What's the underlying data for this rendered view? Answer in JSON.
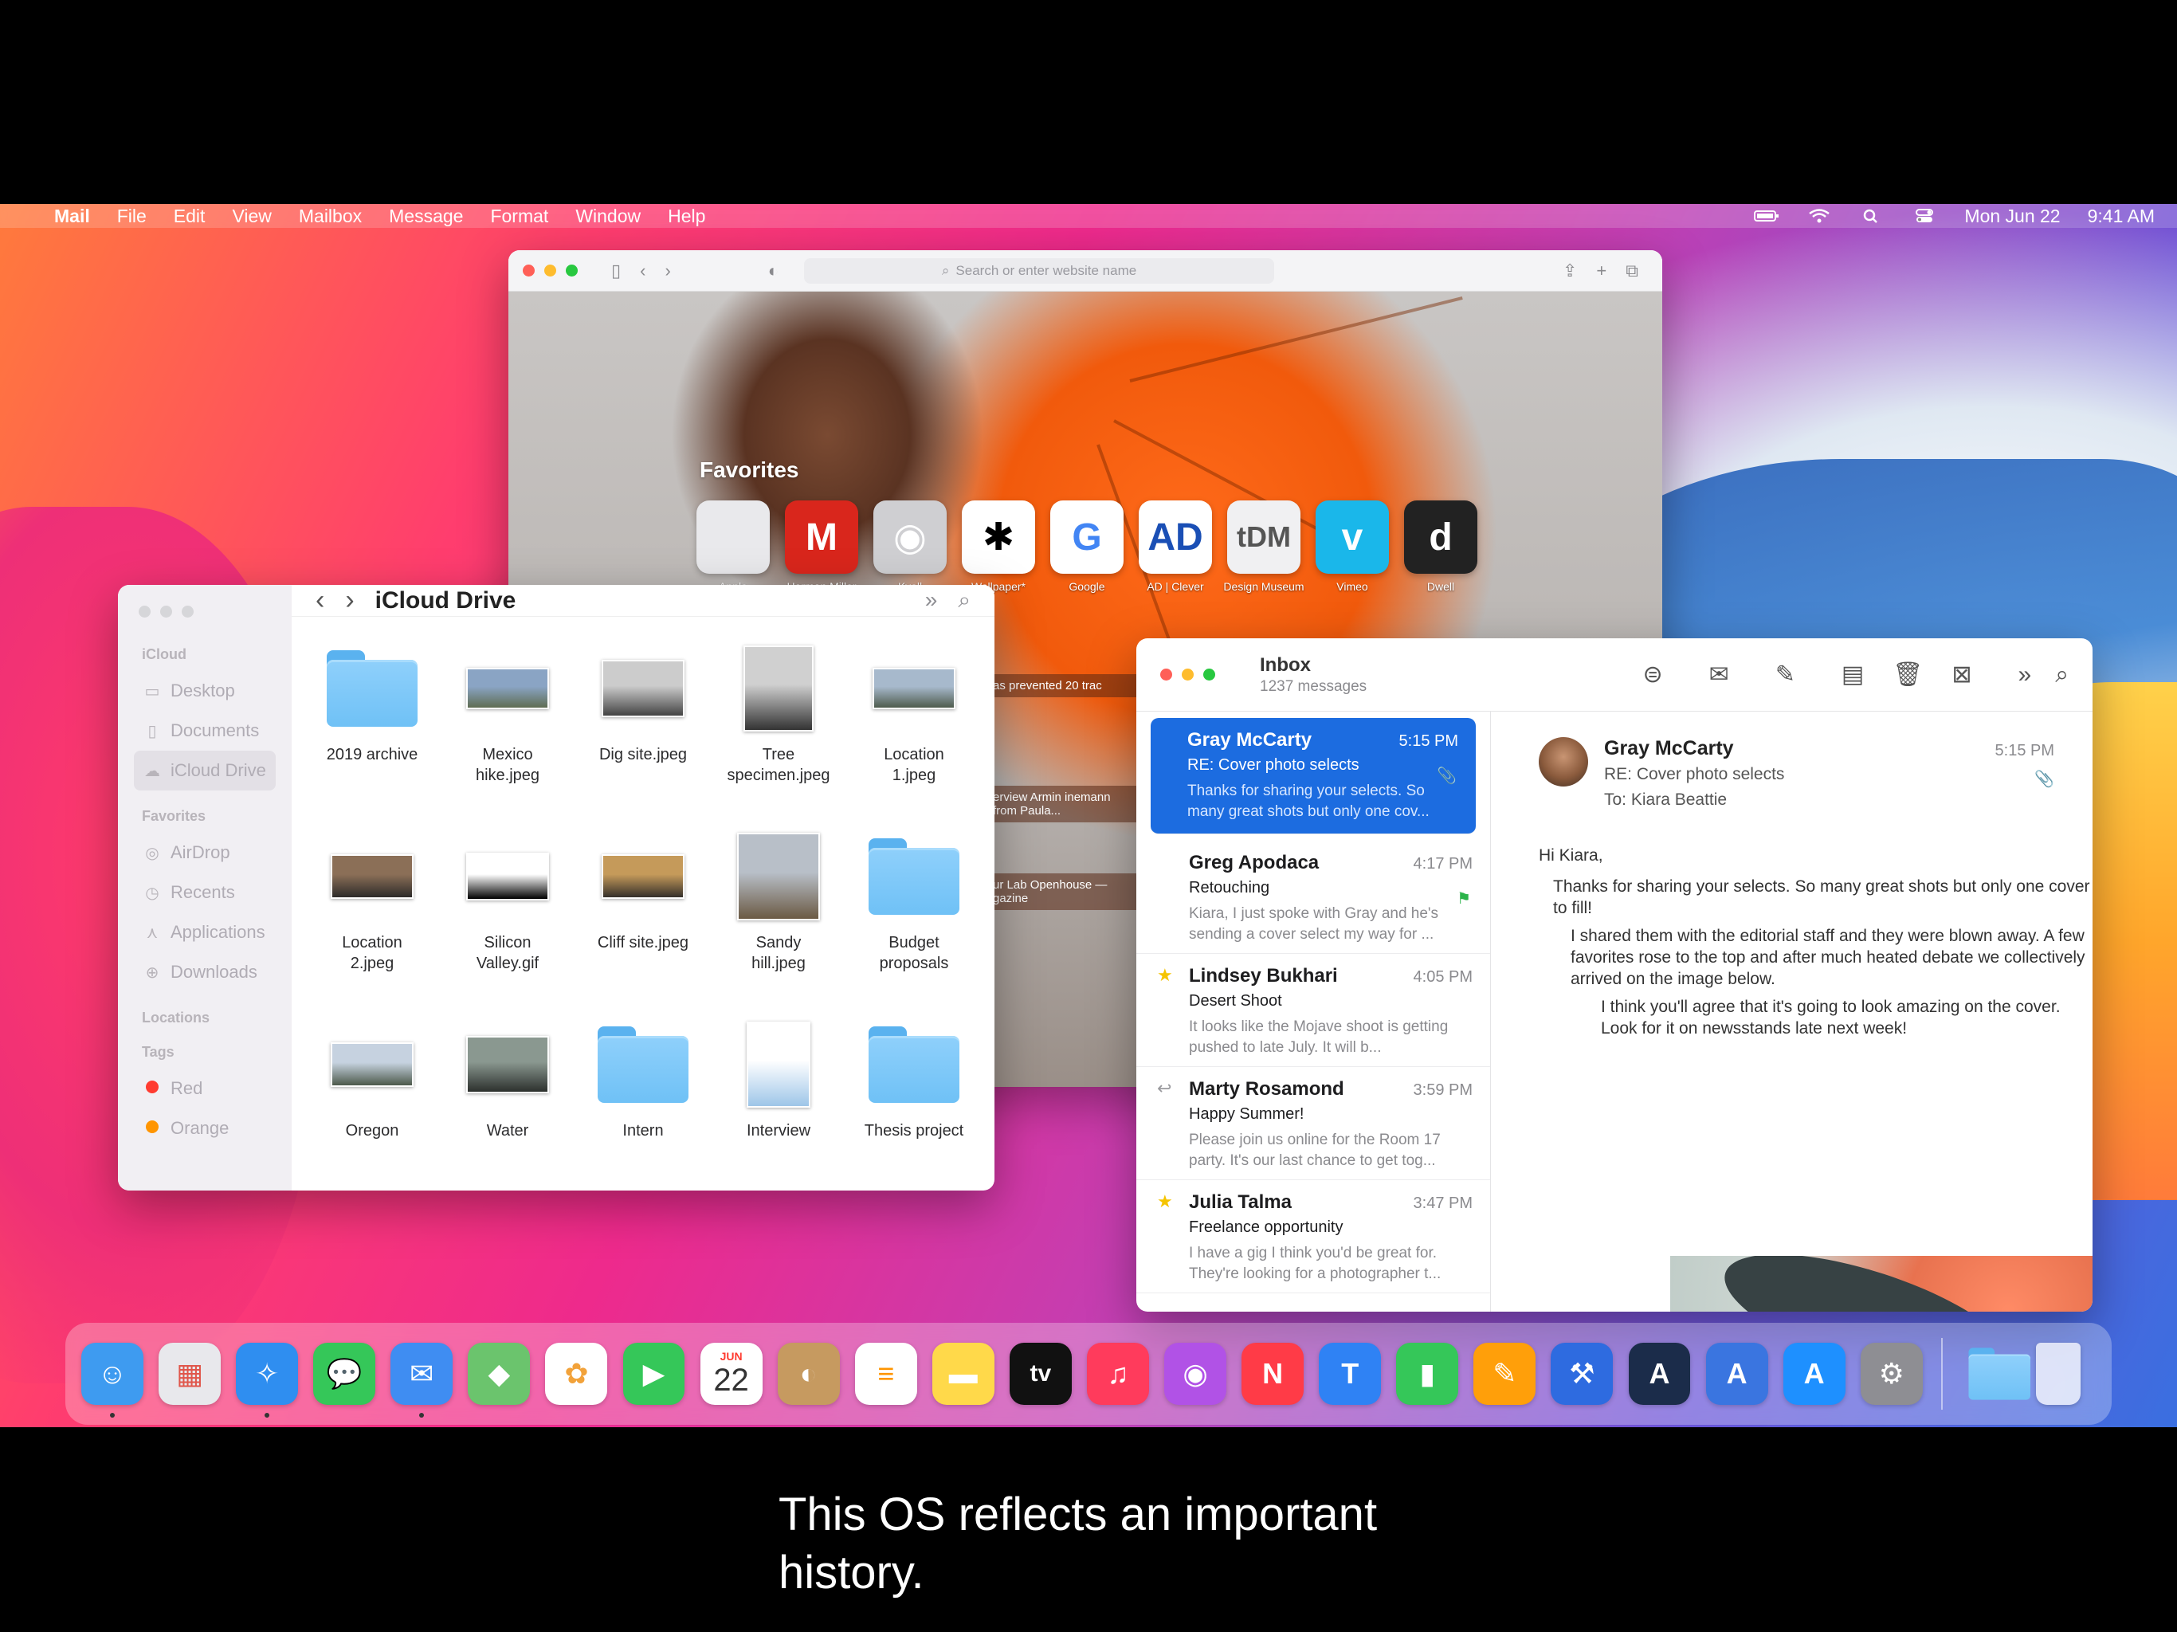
{
  "menubar": {
    "app": "Mail",
    "menus": [
      "File",
      "Edit",
      "View",
      "Mailbox",
      "Message",
      "Format",
      "Window",
      "Help"
    ],
    "date": "Mon Jun 22",
    "time": "9:41 AM"
  },
  "safari": {
    "address_placeholder": "Search or enter website name",
    "favorites_title": "Favorites",
    "favorites": [
      {
        "label": "Apple",
        "glyph": "",
        "bg": "#e9e9ec",
        "fg": "#555"
      },
      {
        "label": "Herman Miller",
        "glyph": "M",
        "bg": "#d9261c",
        "fg": "#fff"
      },
      {
        "label": "Kvell",
        "glyph": "◉",
        "bg": "#cfcfd2",
        "fg": "#fff"
      },
      {
        "label": "Wallpaper*",
        "glyph": "✱",
        "bg": "#ffffff",
        "fg": "#000"
      },
      {
        "label": "Google",
        "glyph": "G",
        "bg": "#ffffff",
        "fg": "#4285f4"
      },
      {
        "label": "AD | Clever",
        "glyph": "AD",
        "bg": "#ffffff",
        "fg": "#1a4fb5"
      },
      {
        "label": "Design Museum",
        "glyph": "tDM",
        "bg": "#f0f0f2",
        "fg": "#555"
      },
      {
        "label": "Vimeo",
        "glyph": "v",
        "bg": "#1ab7ea",
        "fg": "#fff"
      },
      {
        "label": "Dwell",
        "glyph": "d",
        "bg": "#222222",
        "fg": "#fff"
      }
    ],
    "snippets": [
      "as prevented 20 trac",
      "erview Armin inemann from Paula...",
      "ur Lab Openhouse — gazine"
    ]
  },
  "finder": {
    "title": "iCloud Drive",
    "sidebar": {
      "icloud_head": "iCloud",
      "icloud_items": [
        {
          "label": "Desktop",
          "icon": "▭"
        },
        {
          "label": "Documents",
          "icon": "▯"
        },
        {
          "label": "iCloud Drive",
          "icon": "☁"
        }
      ],
      "favorites_head": "Favorites",
      "favorite_items": [
        {
          "label": "AirDrop",
          "icon": "◎"
        },
        {
          "label": "Recents",
          "icon": "◷"
        },
        {
          "label": "Applications",
          "icon": "⋏"
        },
        {
          "label": "Downloads",
          "icon": "⊕"
        }
      ],
      "locations_head": "Locations",
      "tags_head": "Tags",
      "tags": [
        {
          "label": "Red",
          "color": "#ff3b30"
        },
        {
          "label": "Orange",
          "color": "#ff9500"
        }
      ]
    },
    "files": [
      {
        "name": "2019 archive",
        "kind": "folder"
      },
      {
        "name": "Mexico hike.jpeg",
        "kind": "photo",
        "colors": [
          "#8aa4c4",
          "#5f6d52"
        ],
        "w": 104,
        "h": 52
      },
      {
        "name": "Dig site.jpeg",
        "kind": "photo",
        "colors": [
          "#ccc",
          "#444"
        ],
        "w": 104,
        "h": 72
      },
      {
        "name": "Tree specimen.jpeg",
        "kind": "photo",
        "colors": [
          "#d0d0d0",
          "#333"
        ],
        "w": 88,
        "h": 108
      },
      {
        "name": "Location 1.jpeg",
        "kind": "photo",
        "colors": [
          "#a7b9cc",
          "#4e5b4d"
        ],
        "w": 104,
        "h": 52
      },
      {
        "name": "Location 2.jpeg",
        "kind": "photo",
        "colors": [
          "#8b6f57",
          "#2d2b2a"
        ],
        "w": 104,
        "h": 56
      },
      {
        "name": "Silicon Valley.gif",
        "kind": "photo",
        "colors": [
          "#fff",
          "#000"
        ],
        "w": 104,
        "h": 60
      },
      {
        "name": "Cliff site.jpeg",
        "kind": "photo",
        "colors": [
          "#c59a5a",
          "#35302b"
        ],
        "w": 104,
        "h": 56
      },
      {
        "name": "Sandy hill.jpeg",
        "kind": "photo",
        "colors": [
          "#b8bfc8",
          "#6b5a44"
        ],
        "w": 104,
        "h": 110
      },
      {
        "name": "Budget proposals",
        "kind": "folder"
      },
      {
        "name": "Oregon",
        "kind": "photo",
        "colors": [
          "#c6d2e0",
          "#4d5a4b"
        ],
        "w": 104,
        "h": 56
      },
      {
        "name": "Water",
        "kind": "photo",
        "colors": [
          "#8a9890",
          "#2c302d"
        ],
        "w": 104,
        "h": 72
      },
      {
        "name": "Intern",
        "kind": "folder"
      },
      {
        "name": "Interview",
        "kind": "photo",
        "colors": [
          "#ffffff",
          "#9ec6e8"
        ],
        "w": 80,
        "h": 108
      },
      {
        "name": "Thesis project",
        "kind": "folder"
      }
    ]
  },
  "mail": {
    "inbox_title": "Inbox",
    "inbox_count": "1237 messages",
    "messages": [
      {
        "from": "Gray McCarty",
        "time": "5:15 PM",
        "subject": "RE: Cover photo selects",
        "preview": "Thanks for sharing your selects. So many great shots but only one cov...",
        "selected": true,
        "mark": "",
        "flag": "📎"
      },
      {
        "from": "Greg Apodaca",
        "time": "4:17 PM",
        "subject": "Retouching",
        "preview": "Kiara, I just spoke with Gray and he's sending a cover select my way for ...",
        "selected": false,
        "mark": "",
        "flag": "⚑"
      },
      {
        "from": "Lindsey Bukhari",
        "time": "4:05 PM",
        "subject": "Desert Shoot",
        "preview": "It looks like the Mojave shoot is getting pushed to late July. It will b...",
        "selected": false,
        "mark": "★",
        "flag": ""
      },
      {
        "from": "Marty Rosamond",
        "time": "3:59 PM",
        "subject": "Happy Summer!",
        "preview": "Please join us online for the Room 17 party. It's our last chance to get tog...",
        "selected": false,
        "mark": "↩",
        "flag": ""
      },
      {
        "from": "Julia Talma",
        "time": "3:47 PM",
        "subject": "Freelance opportunity",
        "preview": "I have a gig I think you'd be great for. They're looking for a photographer t...",
        "selected": false,
        "mark": "★",
        "flag": ""
      }
    ],
    "reader": {
      "from": "Gray McCarty",
      "subject": "RE: Cover photo selects",
      "to_label": "To:",
      "to": "Kiara Beattie",
      "time": "5:15 PM",
      "greeting": "Hi Kiara,",
      "line1": "Thanks for sharing your selects. So many great shots but only one cover to fill!",
      "line2": "I shared them with the editorial staff and they were blown away. A few favorites rose to the top and after much heated debate we collectively arrived on the image below.",
      "line3": "I think you'll agree that it's going to look amazing on the cover. Look for it on newsstands late next week!"
    }
  },
  "dock": {
    "calendar_month": "JUN",
    "calendar_day": "22",
    "tv_label": "tv",
    "apps": [
      {
        "name": "finder",
        "glyph": "☺",
        "bg": "#3e9bf0",
        "running": true
      },
      {
        "name": "launchpad",
        "glyph": "▦",
        "bg": "#e8e8ec",
        "fg": "#e0564b",
        "running": false
      },
      {
        "name": "safari",
        "glyph": "✧",
        "bg": "#2f8ef0",
        "running": true
      },
      {
        "name": "messages",
        "glyph": "💬",
        "bg": "#35c759",
        "running": false
      },
      {
        "name": "mail",
        "glyph": "✉",
        "bg": "#3f8df2",
        "running": true
      },
      {
        "name": "maps",
        "glyph": "◆",
        "bg": "#6bc46d",
        "running": false
      },
      {
        "name": "photos",
        "glyph": "✿",
        "bg": "#ffffff",
        "fg": "#f2a23a",
        "running": false
      },
      {
        "name": "facetime",
        "glyph": "▶",
        "bg": "#35c759",
        "running": false
      },
      {
        "name": "calendar",
        "glyph": "",
        "bg": "#ffffff",
        "fg": "#333",
        "running": false
      },
      {
        "name": "contacts",
        "glyph": "◐",
        "bg": "#c69a60",
        "running": false
      },
      {
        "name": "reminders",
        "glyph": "≡",
        "bg": "#ffffff",
        "fg": "#ff9500",
        "running": false
      },
      {
        "name": "notes",
        "glyph": "▬",
        "bg": "#ffd94a",
        "fg": "#fff",
        "running": false
      },
      {
        "name": "tv",
        "glyph": "",
        "bg": "#111111",
        "running": false
      },
      {
        "name": "music",
        "glyph": "♫",
        "bg": "#ff3b5c",
        "running": false
      },
      {
        "name": "podcasts",
        "glyph": "◉",
        "bg": "#b152e6",
        "running": false
      },
      {
        "name": "news",
        "glyph": "N",
        "bg": "#ff3b47",
        "running": false
      },
      {
        "name": "keynote",
        "glyph": "T",
        "bg": "#2f82f4",
        "running": false
      },
      {
        "name": "numbers",
        "glyph": "▮",
        "bg": "#35c759",
        "running": false
      },
      {
        "name": "pages",
        "glyph": "✎",
        "bg": "#ff9f0a",
        "running": false
      },
      {
        "name": "xcode",
        "glyph": "⚒",
        "bg": "#2e6be0",
        "running": false
      },
      {
        "name": "instruments",
        "glyph": "A",
        "bg": "#1b2c4a",
        "running": false
      },
      {
        "name": "simulator",
        "glyph": "A",
        "bg": "#3a75e0",
        "running": false
      },
      {
        "name": "app-store",
        "glyph": "A",
        "bg": "#1e90ff",
        "running": false
      },
      {
        "name": "system-preferences",
        "glyph": "⚙",
        "bg": "#8e8e93",
        "running": false
      }
    ]
  },
  "caption": {
    "line1": "This OS reflects an important",
    "line2": "history."
  }
}
